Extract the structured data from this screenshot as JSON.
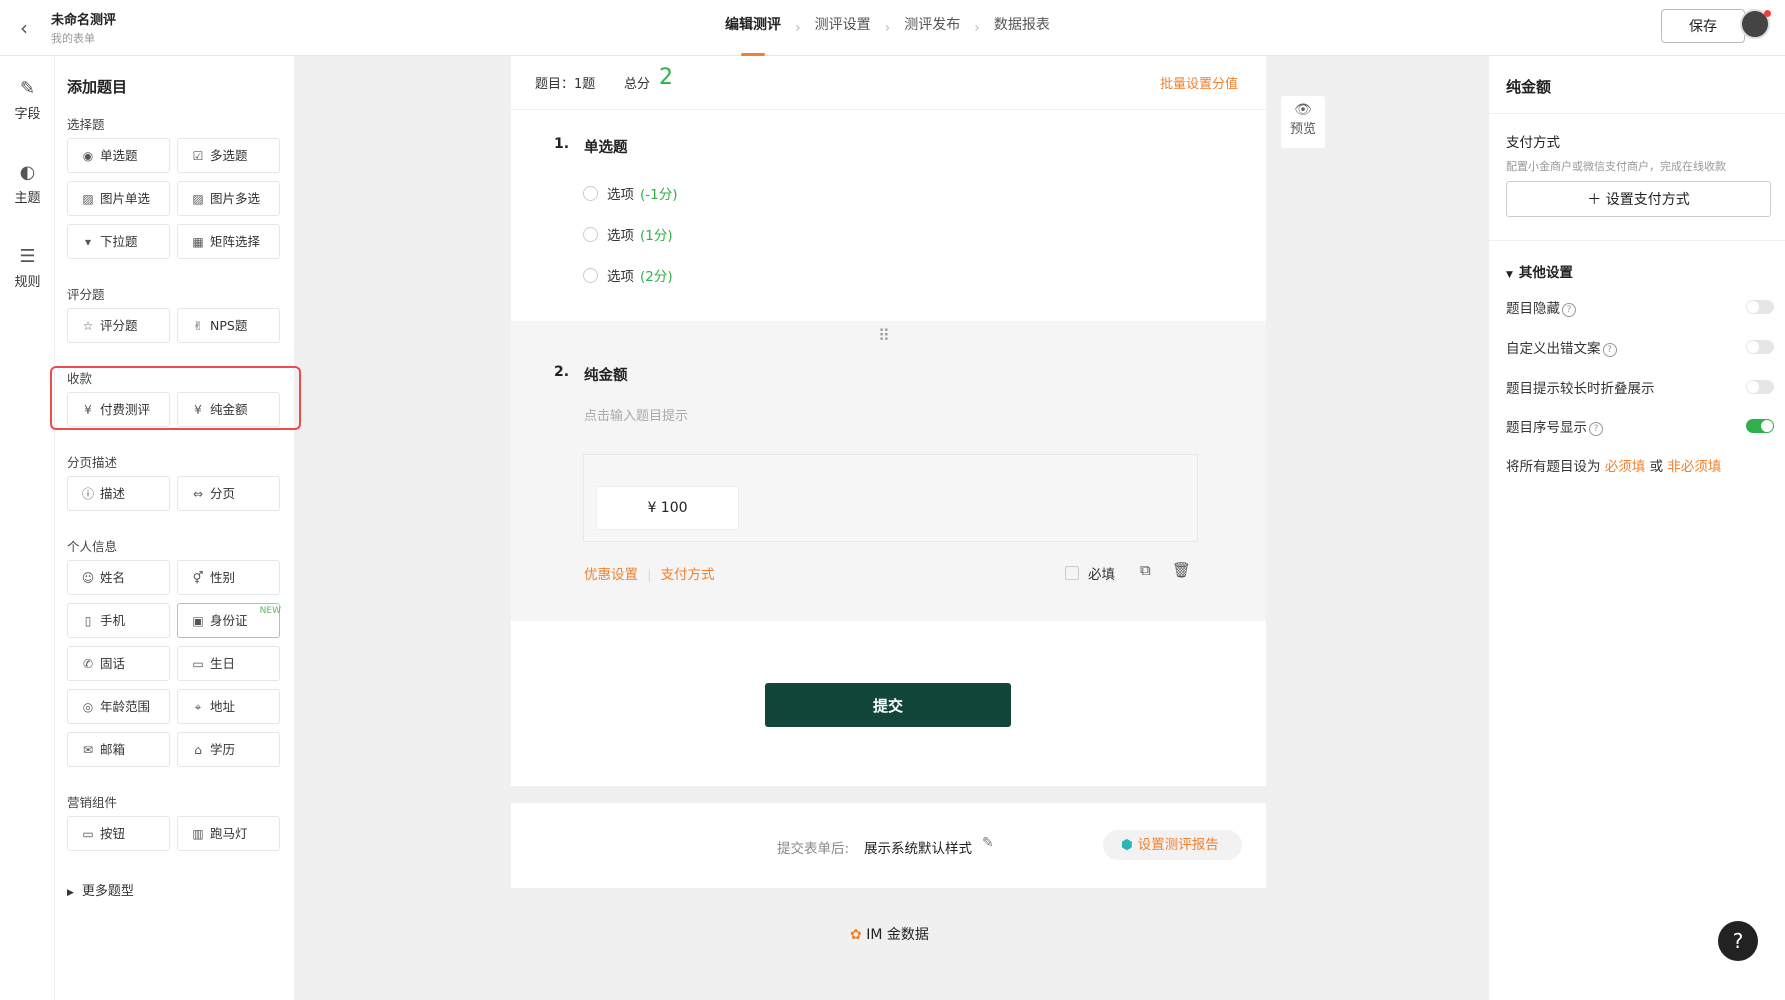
{
  "header": {
    "title": "未命名测评",
    "subtitle": "我的表单",
    "steps": [
      "编辑测评",
      "测评设置",
      "测评发布",
      "数据报表"
    ],
    "save_label": "保存"
  },
  "rail": {
    "fields": "字段",
    "theme": "主题",
    "rules": "规则"
  },
  "panel": {
    "title": "添加题目",
    "sections": {
      "choice": "选择题",
      "rating": "评分题",
      "payment": "收款",
      "page": "分页描述",
      "personal": "个人信息",
      "marketing": "营销组件"
    },
    "items": {
      "single": "单选题",
      "multi": "多选题",
      "img_single": "图片单选",
      "img_multi": "图片多选",
      "dropdown": "下拉题",
      "matrix": "矩阵选择",
      "rating": "评分题",
      "nps": "NPS题",
      "paid_test": "付费测评",
      "pure_amount": "纯金额",
      "describe": "描述",
      "paginate": "分页",
      "name": "姓名",
      "gender": "性别",
      "phone": "手机",
      "id_card": "身份证",
      "landline": "固话",
      "birthday": "生日",
      "age_range": "年龄范围",
      "address": "地址",
      "email": "邮箱",
      "education": "学历",
      "button": "按钮",
      "marquee": "跑马灯"
    },
    "new_tag": "NEW",
    "more": "更多题型"
  },
  "editor": {
    "question_count": "题目：1题",
    "total_label": "总分",
    "total_value": "2",
    "batch_label": "批量设置分值",
    "q1": {
      "num": "1.",
      "title": "单选题",
      "options": [
        {
          "label": "选项",
          "score": "(-1分)"
        },
        {
          "label": "选项",
          "score": "(1分)"
        },
        {
          "label": "选项",
          "score": "(2分)"
        }
      ]
    },
    "q2": {
      "num": "2.",
      "title": "纯金额",
      "hint": "点击输入题目提示",
      "amount": "¥ 100",
      "discount": "优惠设置",
      "payment": "支付方式",
      "required": "必填"
    },
    "submit": "提交"
  },
  "preview": "预览",
  "after": {
    "label": "提交表单后:",
    "value": "展示系统默认样式",
    "report": "设置测评报告"
  },
  "brand": "IM 金数据",
  "right": {
    "title": "纯金额",
    "pay_title": "支付方式",
    "pay_desc": "配置小金商户或微信支付商户，完成在线收款",
    "pay_button": "设置支付方式",
    "other": "其他设置",
    "settings": [
      {
        "label": "题目隐藏",
        "help": true,
        "on": false
      },
      {
        "label": "自定义出错文案",
        "help": true,
        "on": false
      },
      {
        "label": "题目提示较长时折叠展示",
        "help": false,
        "on": false
      },
      {
        "label": "题目序号显示",
        "help": true,
        "on": true
      }
    ],
    "all_prefix": "将所有题目设为",
    "all_required": "必须填",
    "all_or": "或",
    "all_optional": "非必须填"
  },
  "colors": {
    "accent": "#f0812f",
    "green": "#2fb04a",
    "submit": "#12463b",
    "highlight": "#ee4b4b"
  }
}
